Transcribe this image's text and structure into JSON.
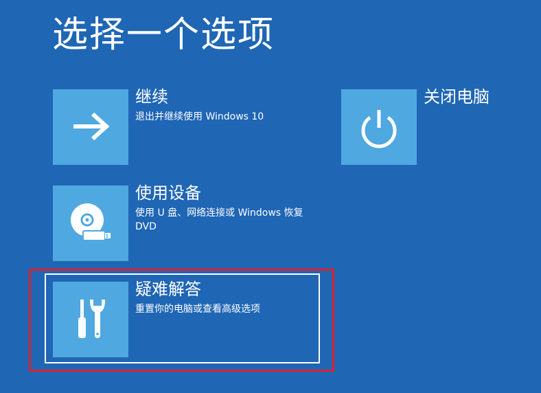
{
  "page": {
    "title": "选择一个选项"
  },
  "options": [
    {
      "id": "continue",
      "title": "继续",
      "description": "退出并继续使用 Windows 10",
      "icon": "arrow-right-icon"
    },
    {
      "id": "use-device",
      "title": "使用设备",
      "description": "使用 U 盘、网络连接或 Windows 恢复 DVD",
      "icon": "disc-usb-icon"
    },
    {
      "id": "troubleshoot",
      "title": "疑难解答",
      "description": "重置你的电脑或查看高级选项",
      "icon": "tools-icon",
      "focused": true,
      "highlighted": true
    },
    {
      "id": "shutdown",
      "title": "关闭电脑",
      "description": "",
      "icon": "power-icon"
    }
  ],
  "colors": {
    "background": "#1f66b5",
    "tile": "#4fa8e0",
    "text": "#ffffff",
    "focus_outline": "#ffffff",
    "annotation_highlight": "#e0202a"
  }
}
